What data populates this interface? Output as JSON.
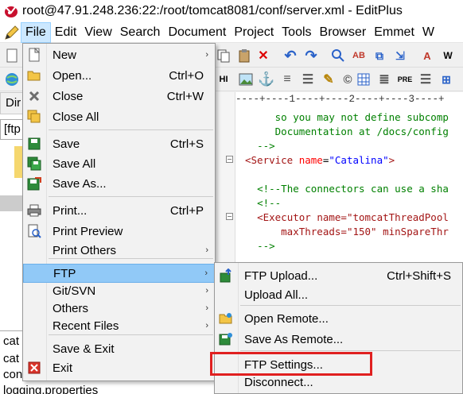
{
  "window": {
    "title": "root@47.91.248.236:22:/root/tomcat8081/conf/server.xml - EditPlus"
  },
  "menubar": {
    "items": [
      {
        "label": "File"
      },
      {
        "label": "Edit"
      },
      {
        "label": "View"
      },
      {
        "label": "Search"
      },
      {
        "label": "Document"
      },
      {
        "label": "Project"
      },
      {
        "label": "Tools"
      },
      {
        "label": "Browser"
      },
      {
        "label": "Emmet"
      },
      {
        "label": "W"
      }
    ]
  },
  "left_panel": {
    "tab_label": "Dir",
    "combo_value": "[ftp",
    "files": [
      "cat",
      "cat",
      "con",
      "logging.properties"
    ]
  },
  "editor": {
    "ruler": "----+----1----+----2----+----3----+",
    "lines": [
      {
        "indent": "     ",
        "parts": [
          {
            "c": "c-com",
            "t": "so you may not define subcomp"
          }
        ]
      },
      {
        "indent": "     ",
        "parts": [
          {
            "c": "c-com",
            "t": "Documentation at /docs/config"
          }
        ]
      },
      {
        "indent": "  ",
        "parts": [
          {
            "c": "c-com",
            "t": "-->"
          }
        ]
      },
      {
        "indent": "",
        "parts": [
          {
            "c": "c-tag",
            "t": "<Service "
          },
          {
            "c": "c-attr",
            "t": "name"
          },
          {
            "c": "c-blk",
            "t": "="
          },
          {
            "c": "c-val",
            "t": "\"Catalina\""
          },
          {
            "c": "c-tag",
            "t": ">"
          }
        ]
      },
      {
        "indent": "",
        "parts": []
      },
      {
        "indent": "  ",
        "parts": [
          {
            "c": "c-com",
            "t": "<!--The connectors can use a sha"
          }
        ]
      },
      {
        "indent": "  ",
        "parts": [
          {
            "c": "c-com",
            "t": "<!--"
          }
        ]
      },
      {
        "indent": "  ",
        "parts": [
          {
            "c": "c-tag",
            "t": "<Executor name=\"tomcatThreadPool"
          }
        ]
      },
      {
        "indent": "      ",
        "parts": [
          {
            "c": "c-tag",
            "t": "maxThreads=\"150\" minSpareThr"
          }
        ]
      },
      {
        "indent": "  ",
        "parts": [
          {
            "c": "c-com",
            "t": "-->"
          }
        ]
      }
    ]
  },
  "file_menu": {
    "items": [
      {
        "label": "New",
        "shortcut": "",
        "submenu": true,
        "icon": "new-file-icon"
      },
      {
        "label": "Open...",
        "shortcut": "Ctrl+O",
        "submenu": false,
        "icon": "open-folder-icon"
      },
      {
        "label": "Close",
        "shortcut": "Ctrl+W",
        "submenu": false,
        "icon": "close-x-icon"
      },
      {
        "label": "Close All",
        "shortcut": "",
        "submenu": false,
        "icon": "close-all-icon"
      },
      {
        "label": "Save",
        "shortcut": "Ctrl+S",
        "submenu": false,
        "icon": "save-disk-icon"
      },
      {
        "label": "Save All",
        "shortcut": "",
        "submenu": false,
        "icon": "save-all-icon"
      },
      {
        "label": "Save As...",
        "shortcut": "",
        "submenu": false,
        "icon": "save-as-icon"
      },
      {
        "label": "Print...",
        "shortcut": "Ctrl+P",
        "submenu": false,
        "icon": "printer-icon"
      },
      {
        "label": "Print Preview",
        "shortcut": "",
        "submenu": false,
        "icon": "print-preview-icon"
      },
      {
        "label": "Print Others",
        "shortcut": "",
        "submenu": true,
        "icon": ""
      },
      {
        "label": "FTP",
        "shortcut": "",
        "submenu": true,
        "icon": ""
      },
      {
        "label": "Git/SVN",
        "shortcut": "",
        "submenu": true,
        "icon": ""
      },
      {
        "label": "Others",
        "shortcut": "",
        "submenu": true,
        "icon": ""
      },
      {
        "label": "Recent Files",
        "shortcut": "",
        "submenu": true,
        "icon": ""
      },
      {
        "label": "Save & Exit",
        "shortcut": "",
        "submenu": false,
        "icon": ""
      },
      {
        "label": "Exit",
        "shortcut": "",
        "submenu": false,
        "icon": "exit-icon"
      }
    ]
  },
  "ftp_menu": {
    "items": [
      {
        "label": "FTP Upload...",
        "shortcut": "Ctrl+Shift+S",
        "icon": "ftp-upload-icon"
      },
      {
        "label": "Upload All...",
        "shortcut": "",
        "icon": ""
      },
      {
        "label": "Open Remote...",
        "shortcut": "",
        "icon": "open-remote-icon"
      },
      {
        "label": "Save As Remote...",
        "shortcut": "",
        "icon": "save-remote-icon"
      },
      {
        "label": "FTP Settings...",
        "shortcut": "",
        "icon": ""
      },
      {
        "label": "Disconnect...",
        "shortcut": "",
        "icon": ""
      }
    ]
  },
  "colors": {
    "highlight": "#91c9f7",
    "callout": "#e02020"
  }
}
